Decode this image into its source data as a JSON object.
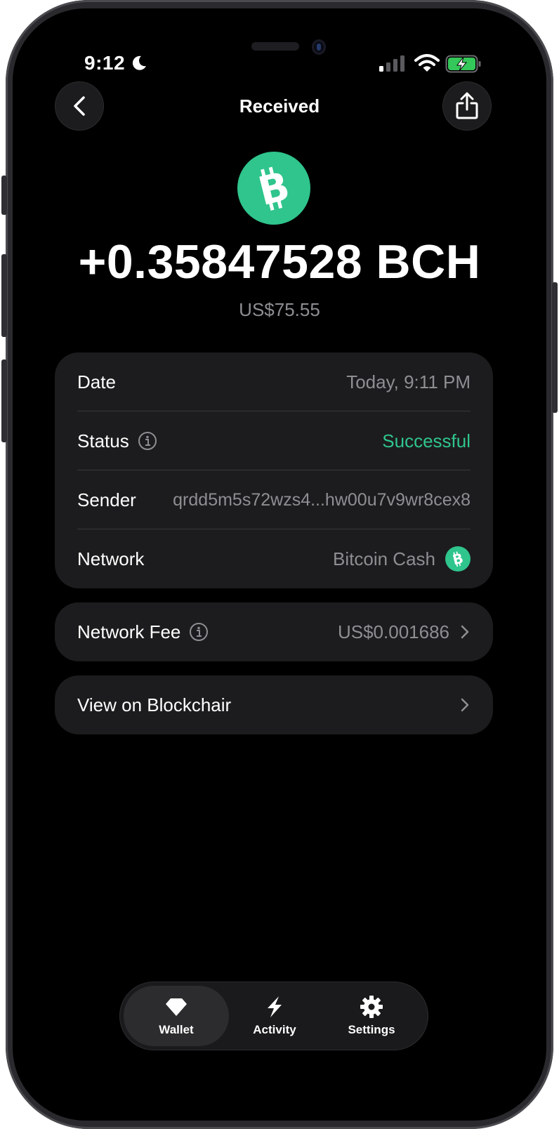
{
  "status_bar": {
    "time": "9:12",
    "icons": [
      "moon-icon",
      "signal-icon",
      "wifi-icon",
      "battery-charging-icon"
    ]
  },
  "nav": {
    "title": "Received",
    "back_icon": "chevron-left-icon",
    "share_icon": "share-icon"
  },
  "transaction": {
    "coin_icon": "bitcoin-cash-icon",
    "amount": "+0.35847528 BCH",
    "fiat_amount": "US$75.55"
  },
  "details": [
    {
      "label": "Date",
      "value": "Today, 9:11 PM"
    },
    {
      "label": "Status",
      "value": "Successful"
    },
    {
      "label": "Sender",
      "value": "qrdd5m5s72wzs4...hw00u7v9wr8cex8"
    },
    {
      "label": "Network",
      "value": "Bitcoin Cash"
    }
  ],
  "fee": {
    "label": "Network Fee",
    "value": "US$0.001686"
  },
  "explorer": {
    "label": "View on Blockchair"
  },
  "tabbar": {
    "tabs": [
      {
        "label": "Wallet",
        "icon": "diamond-icon",
        "active": true
      },
      {
        "label": "Activity",
        "icon": "lightning-icon",
        "active": false
      },
      {
        "label": "Settings",
        "icon": "gear-icon",
        "active": false
      }
    ]
  },
  "colors": {
    "background": "#000000",
    "card": "#1c1c1e",
    "accent_green": "#2fc58d",
    "secondary_text": "#8e8e93"
  }
}
